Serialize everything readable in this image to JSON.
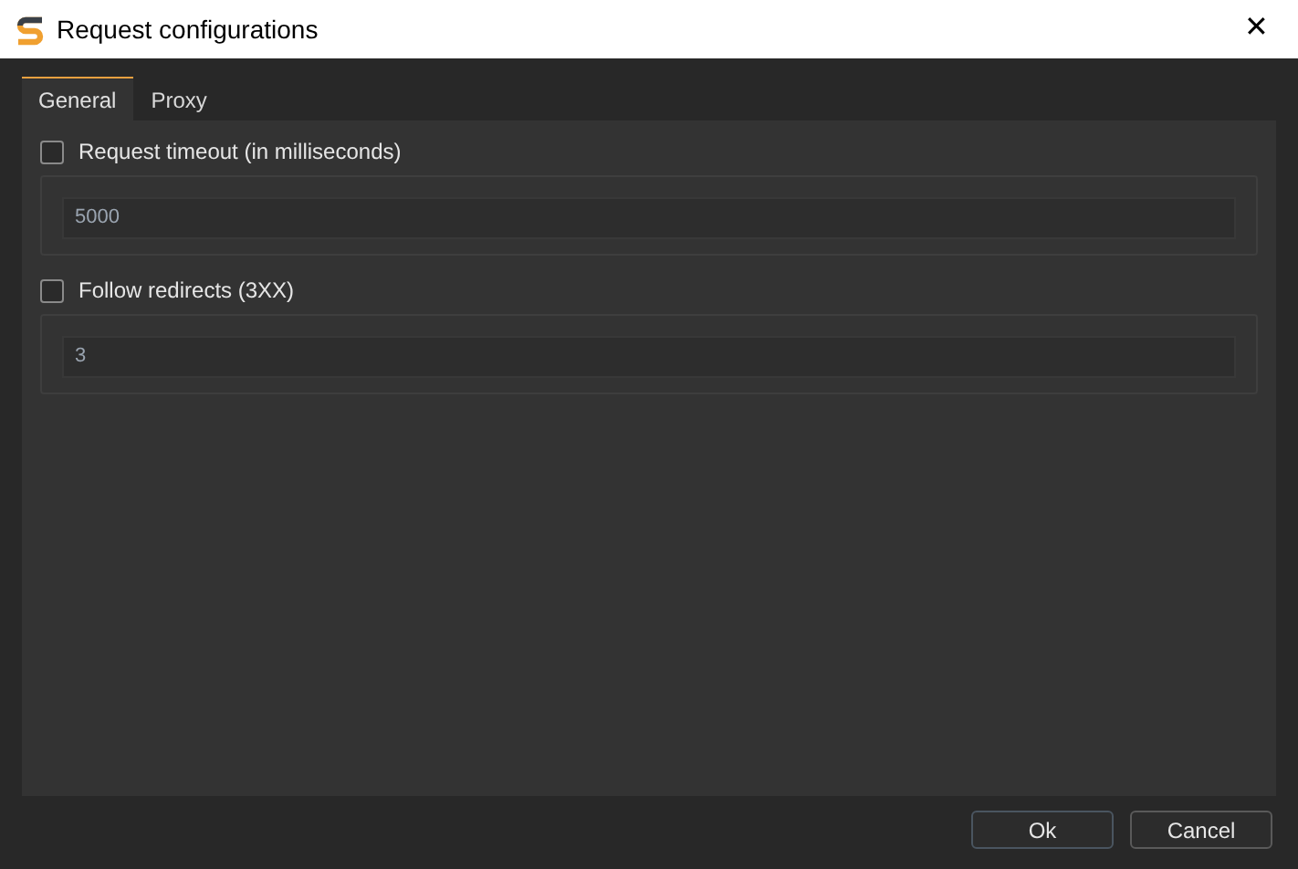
{
  "window": {
    "title": "Request configurations",
    "close": "✕"
  },
  "tabs": [
    {
      "label": "General",
      "selected": true
    },
    {
      "label": "Proxy",
      "selected": false
    }
  ],
  "settings": [
    {
      "label": "Request timeout (in milliseconds)",
      "checked": false,
      "value": "5000"
    },
    {
      "label": "Follow redirects (3XX)",
      "checked": false,
      "value": "3"
    }
  ],
  "buttons": [
    {
      "label": "Ok",
      "default": true
    },
    {
      "label": "Cancel",
      "default": false
    }
  ]
}
